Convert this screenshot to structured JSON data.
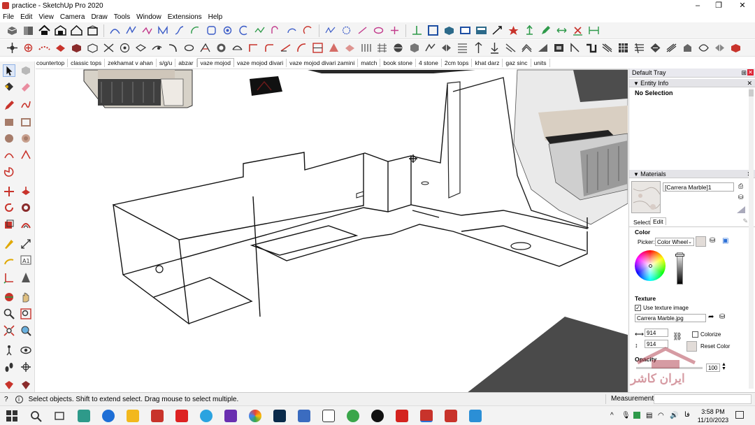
{
  "window": {
    "title": "practice - SketchUp Pro 2020",
    "minimize": "–",
    "maximize": "❐",
    "close": "✕"
  },
  "menu": [
    "File",
    "Edit",
    "View",
    "Camera",
    "Draw",
    "Tools",
    "Window",
    "Extensions",
    "Help"
  ],
  "scene_tabs": [
    "countertop",
    "classic tops",
    "zekhamat v ahan",
    "s/g/u",
    "abzar",
    "vaze mojod",
    "vaze mojod divari",
    "vaze mojod divari zamini",
    "match",
    "book stone",
    "4 stone",
    "2cm tops",
    "khat darz",
    "gaz sinc",
    "units"
  ],
  "active_scene": "vaze mojod",
  "tray": {
    "title": "Default Tray",
    "entity_info": {
      "header": "Entity Info",
      "value": "No Selection"
    },
    "materials": {
      "header": "Materials",
      "name": "[Carrera Marble]1",
      "tab_select": "Select",
      "tab_edit": "Edit",
      "color_label": "Color",
      "picker_label": "Picker:",
      "picker_value": "Color Wheel",
      "texture_label": "Texture",
      "use_texture": "Use texture image",
      "texture_file": "Carrera Marble.jpg",
      "width": "914",
      "height": "914",
      "colorize": "Colorize",
      "reset_color": "Reset Color",
      "opacity_label": "Opacity",
      "opacity_value": "100"
    }
  },
  "watermark": "ایران کاشر",
  "status": {
    "message": "Select objects. Shift to extend select. Drag mouse to select multiple.",
    "measurements": "Measurements"
  },
  "taskbar": {
    "time": "3:58 PM",
    "date": "11/10/2023",
    "lang": "فا"
  },
  "colors": {
    "accent": "#c8332b",
    "selection_blue": "#2b6fd6",
    "toolbar_bg": "#f4f4f4"
  }
}
